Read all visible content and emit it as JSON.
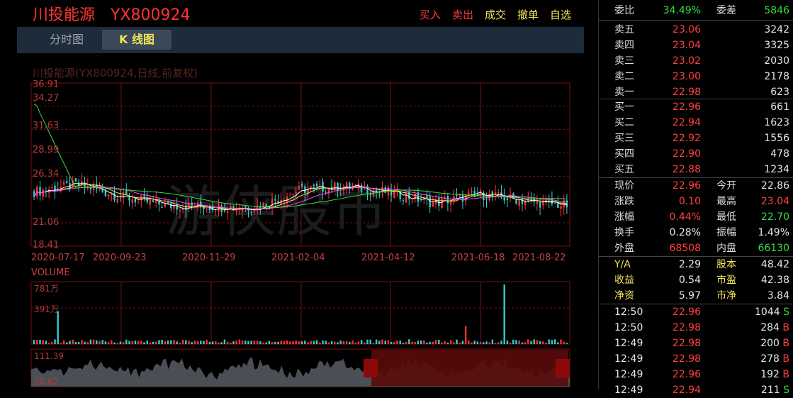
{
  "header": {
    "stock_name": "川投能源",
    "stock_code": "YX800924",
    "actions": [
      "买入",
      "卖出",
      "成交",
      "撤单",
      "自选"
    ]
  },
  "tabs": [
    "分时图",
    "K 线图"
  ],
  "chart": {
    "title": "川投能源(YX800924,日线,前复权)",
    "watermark": "游侠股市",
    "price_ticks": [
      "36.91",
      "34.27",
      "31.63",
      "28.99",
      "26.34",
      "21.06",
      "18.41"
    ],
    "date_ticks": [
      "2020-07-17",
      "2020-09-23",
      "2020-11-29",
      "2021-02-04",
      "2021-04-12",
      "2021-06-18",
      "2021-08-22"
    ],
    "volume_label": "VOLUME",
    "volume_ticks": [
      "781万",
      "391万"
    ],
    "mini_ticks": [
      "111.39",
      "20.62"
    ],
    "colors": {
      "up": "#ff3232",
      "down": "#33cccc",
      "ma5": "#ffffff",
      "ma10": "#f0e35a",
      "ma20": "#ff44ff",
      "ma60": "#33dd44",
      "grid": "#7a1010"
    }
  },
  "chart_data": {
    "type": "candlestick",
    "title": "川投能源(YX800924,日线,前复权)",
    "x_range": [
      "2020-07-17",
      "2021-08-22"
    ],
    "ylim": [
      18.41,
      36.91
    ],
    "volume_ylim": [
      0,
      781
    ],
    "volume_unit": "万",
    "approx_close_series": [
      {
        "date": "2020-07-17",
        "close": 24.6
      },
      {
        "date": "2020-08-10",
        "close": 25.4
      },
      {
        "date": "2020-09-23",
        "close": 24.0
      },
      {
        "date": "2020-10-20",
        "close": 23.0
      },
      {
        "date": "2020-11-29",
        "close": 22.9
      },
      {
        "date": "2021-01-05",
        "close": 22.8
      },
      {
        "date": "2021-02-04",
        "close": 24.8
      },
      {
        "date": "2021-03-05",
        "close": 25.2
      },
      {
        "date": "2021-04-12",
        "close": 24.5
      },
      {
        "date": "2021-05-15",
        "close": 23.3
      },
      {
        "date": "2021-06-18",
        "close": 24.3
      },
      {
        "date": "2021-07-20",
        "close": 23.6
      },
      {
        "date": "2021-08-22",
        "close": 23.0
      }
    ],
    "grid": true
  },
  "quote": {
    "weibi_label": "委比",
    "weibi": "34.49%",
    "weicha_label": "委差",
    "weicha": "5846",
    "asks": [
      {
        "label": "卖五",
        "price": "23.06",
        "vol": "3242"
      },
      {
        "label": "卖四",
        "price": "23.04",
        "vol": "3325"
      },
      {
        "label": "卖三",
        "price": "23.02",
        "vol": "2030"
      },
      {
        "label": "卖二",
        "price": "23.00",
        "vol": "2178"
      },
      {
        "label": "卖一",
        "price": "22.98",
        "vol": "623"
      }
    ],
    "bids": [
      {
        "label": "买一",
        "price": "22.96",
        "vol": "661"
      },
      {
        "label": "买二",
        "price": "22.94",
        "vol": "1623"
      },
      {
        "label": "买三",
        "price": "22.92",
        "vol": "1556"
      },
      {
        "label": "买四",
        "price": "22.90",
        "vol": "478"
      },
      {
        "label": "买五",
        "price": "22.88",
        "vol": "1234"
      }
    ],
    "stats": [
      {
        "l1": "现价",
        "v1": "22.96",
        "c1": "red",
        "l2": "今开",
        "v2": "22.86",
        "c2": "white"
      },
      {
        "l1": "涨跌",
        "v1": "0.10",
        "c1": "red",
        "l2": "最高",
        "v2": "23.04",
        "c2": "red"
      },
      {
        "l1": "涨幅",
        "v1": "0.44%",
        "c1": "red",
        "l2": "最低",
        "v2": "22.70",
        "c2": "green"
      },
      {
        "l1": "换手",
        "v1": "0.28%",
        "c1": "white",
        "l2": "振幅",
        "v2": "1.49%",
        "c2": "white"
      },
      {
        "l1": "外盘",
        "v1": "68508",
        "c1": "red",
        "l2": "内盘",
        "v2": "66130",
        "c2": "green"
      }
    ],
    "fund": [
      {
        "l1": "Y/A",
        "v1": "2.29",
        "l2": "股本",
        "v2": "48.42"
      },
      {
        "l1": "收益",
        "v1": "0.54",
        "l2": "市盈",
        "v2": "42.38"
      },
      {
        "l1": "净资",
        "v1": "5.97",
        "l2": "市净",
        "v2": "3.84"
      }
    ],
    "ticks": [
      {
        "time": "12:50",
        "price": "22.96",
        "vol": "1044",
        "side": "S"
      },
      {
        "time": "12:50",
        "price": "22.98",
        "vol": "284",
        "side": "B"
      },
      {
        "time": "12:49",
        "price": "22.98",
        "vol": "200",
        "side": "B"
      },
      {
        "time": "12:49",
        "price": "22.98",
        "vol": "278",
        "side": "B"
      },
      {
        "time": "12:49",
        "price": "22.96",
        "vol": "192",
        "side": "B"
      },
      {
        "time": "12:49",
        "price": "22.94",
        "vol": "211",
        "side": "S"
      }
    ]
  }
}
